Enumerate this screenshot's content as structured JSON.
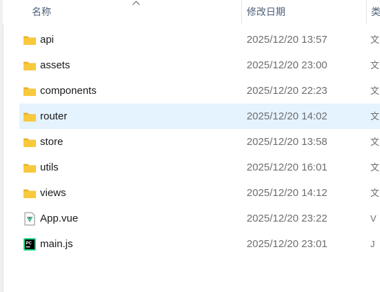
{
  "header": {
    "name_label": "名称",
    "date_label": "修改日期",
    "extra_label": "类"
  },
  "files": [
    {
      "name": "api",
      "date": "2025/12/20 13:57",
      "type_fragment": "文",
      "icon": "folder-icon"
    },
    {
      "name": "assets",
      "date": "2025/12/20 23:00",
      "type_fragment": "文",
      "icon": "folder-icon"
    },
    {
      "name": "components",
      "date": "2025/12/20 22:23",
      "type_fragment": "文",
      "icon": "folder-icon"
    },
    {
      "name": "router",
      "date": "2025/12/20 14:02",
      "type_fragment": "文",
      "icon": "folder-icon",
      "selected": true
    },
    {
      "name": "store",
      "date": "2025/12/20 13:58",
      "type_fragment": "文",
      "icon": "folder-icon"
    },
    {
      "name": "utils",
      "date": "2025/12/20 16:01",
      "type_fragment": "文",
      "icon": "folder-icon"
    },
    {
      "name": "views",
      "date": "2025/12/20 14:12",
      "type_fragment": "文",
      "icon": "folder-icon"
    },
    {
      "name": "App.vue",
      "date": "2025/12/20 23:22",
      "type_fragment": "V",
      "icon": "vue-file-icon"
    },
    {
      "name": "main.js",
      "date": "2025/12/20 23:01",
      "type_fragment": "J",
      "icon": "pycharm-file-icon"
    }
  ],
  "colors": {
    "selection": "#e5f3ff",
    "folder": "#f8c93c",
    "header_text": "#4c607a"
  }
}
